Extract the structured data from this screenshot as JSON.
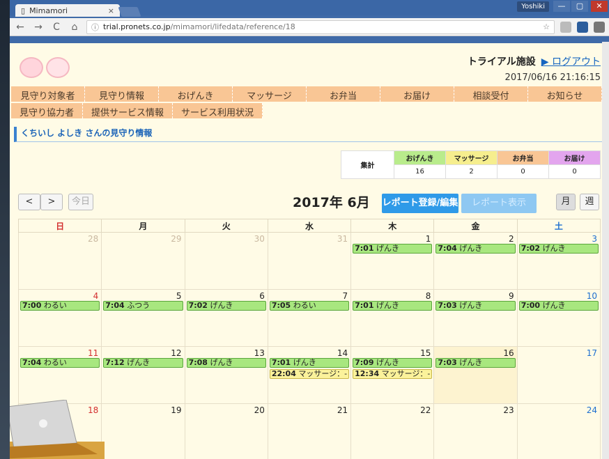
{
  "browser": {
    "tab_title": "Mimamori",
    "tab_close": "×",
    "user": "Yoshiki",
    "url_host": "trial.pronets.co.jp",
    "url_path": "/mimamori/lifedata/reference/18",
    "nav_back": "←",
    "nav_forward": "→",
    "nav_reload": "C",
    "nav_home": "⌂",
    "star": "☆"
  },
  "header": {
    "facility": "トライアル施設",
    "logout": "▶ ログアウト",
    "datetime": "2017/06/16 21:16:15"
  },
  "nav_row1": [
    "見守り対象者",
    "見守り情報",
    "おげんき",
    "マッサージ",
    "お弁当",
    "お届け",
    "相談受付",
    "お知らせ"
  ],
  "nav_row2": [
    "見守り協力者",
    "提供サービス情報",
    "サービス利用状況"
  ],
  "section_title": "くちいし よしき さんの見守り情報",
  "summary": {
    "label": "集計",
    "headers": [
      "おげんき",
      "マッサージ",
      "お弁当",
      "お届け"
    ],
    "values": [
      "16",
      "2",
      "0",
      "0"
    ]
  },
  "calendar_toolbar": {
    "prev": "<",
    "next": ">",
    "today": "今日",
    "title": "2017年 6月",
    "report_edit": "レポート登録/編集",
    "report_view": "レポート表示",
    "month": "月",
    "week": "週"
  },
  "weekdays": [
    "日",
    "月",
    "火",
    "水",
    "木",
    "金",
    "土"
  ],
  "weeks": [
    [
      {
        "day": "28",
        "other": true,
        "events": []
      },
      {
        "day": "29",
        "other": true,
        "events": []
      },
      {
        "day": "30",
        "other": true,
        "events": []
      },
      {
        "day": "31",
        "other": true,
        "events": []
      },
      {
        "day": "1",
        "events": [
          {
            "time": "7:01",
            "text": "げんき",
            "kind": "green"
          }
        ]
      },
      {
        "day": "2",
        "events": [
          {
            "time": "7:04",
            "text": "げんき",
            "kind": "green"
          }
        ]
      },
      {
        "day": "3",
        "events": [
          {
            "time": "7:02",
            "text": "げんき",
            "kind": "green"
          }
        ]
      }
    ],
    [
      {
        "day": "4",
        "events": [
          {
            "time": "7:00",
            "text": "わるい",
            "kind": "green"
          }
        ]
      },
      {
        "day": "5",
        "events": [
          {
            "time": "7:04",
            "text": "ふつう",
            "kind": "green"
          }
        ]
      },
      {
        "day": "6",
        "events": [
          {
            "time": "7:02",
            "text": "げんき",
            "kind": "green"
          }
        ]
      },
      {
        "day": "7",
        "events": [
          {
            "time": "7:05",
            "text": "わるい",
            "kind": "green"
          }
        ]
      },
      {
        "day": "8",
        "events": [
          {
            "time": "7:01",
            "text": "げんき",
            "kind": "green"
          }
        ]
      },
      {
        "day": "9",
        "events": [
          {
            "time": "7:03",
            "text": "げんき",
            "kind": "green"
          }
        ]
      },
      {
        "day": "10",
        "events": [
          {
            "time": "7:00",
            "text": "げんき",
            "kind": "green"
          }
        ]
      }
    ],
    [
      {
        "day": "11",
        "events": [
          {
            "time": "7:04",
            "text": "わるい",
            "kind": "green"
          }
        ]
      },
      {
        "day": "12",
        "events": [
          {
            "time": "7:12",
            "text": "げんき",
            "kind": "green"
          }
        ]
      },
      {
        "day": "13",
        "events": [
          {
            "time": "7:08",
            "text": "げんき",
            "kind": "green"
          }
        ]
      },
      {
        "day": "14",
        "events": [
          {
            "time": "7:01",
            "text": "げんき",
            "kind": "green"
          },
          {
            "time": "22:04",
            "text": "マッサージ：-",
            "kind": "yellow"
          }
        ]
      },
      {
        "day": "15",
        "events": [
          {
            "time": "7:09",
            "text": "げんき",
            "kind": "green"
          },
          {
            "time": "12:34",
            "text": "マッサージ：-",
            "kind": "yellow"
          }
        ]
      },
      {
        "day": "16",
        "today": true,
        "events": [
          {
            "time": "7:03",
            "text": "げんき",
            "kind": "green"
          }
        ]
      },
      {
        "day": "17",
        "events": []
      }
    ],
    [
      {
        "day": "18",
        "events": []
      },
      {
        "day": "19",
        "events": []
      },
      {
        "day": "20",
        "events": []
      },
      {
        "day": "21",
        "events": []
      },
      {
        "day": "22",
        "events": []
      },
      {
        "day": "23",
        "events": []
      },
      {
        "day": "24",
        "events": []
      }
    ]
  ],
  "colors": {
    "event_green": "#a8e77f",
    "event_yellow": "#fbf29b",
    "nav_orange": "#f9c695",
    "primary_blue": "#2f9ae8",
    "page_bg": "#fffbe6"
  },
  "icons": {
    "logo": "elderly-faces-logo",
    "laptop": "laptop-illustration"
  }
}
